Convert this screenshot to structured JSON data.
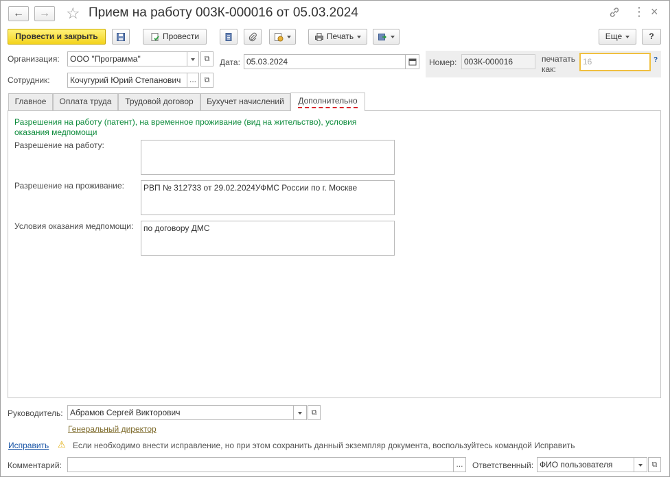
{
  "window": {
    "title": "Прием на работу 003К-000016 от 05.03.2024"
  },
  "toolbar": {
    "post_and_close": "Провести и закрыть",
    "post": "Провести",
    "print": "Печать",
    "more": "Еще",
    "help": "?"
  },
  "header": {
    "organization_label": "Организация:",
    "organization_value": "ООО \"Программа\"",
    "date_label": "Дата:",
    "date_value": "05.03.2024",
    "number_label": "Номер:",
    "number_value": "003К-000016",
    "print_as_label_1": "печатать",
    "print_as_label_2": "как:",
    "print_as_value": "16",
    "print_as_help": "?",
    "employee_label": "Сотрудник:",
    "employee_value": "Кочугурий Юрий Степанович"
  },
  "tabs": [
    {
      "label": "Главное"
    },
    {
      "label": "Оплата труда"
    },
    {
      "label": "Трудовой договор"
    },
    {
      "label": "Бухучет начислений"
    },
    {
      "label": "Дополнительно"
    }
  ],
  "additional": {
    "section_title_1": "Разрешения на работу (патент), на временное проживание (вид на жительство), условия",
    "section_title_2": "оказания медпомощи",
    "work_permit_label": "Разрешение на работу:",
    "work_permit_value": "",
    "residence_permit_label": "Разрешение на проживание:",
    "residence_permit_value": "РВП № 312733 от 29.02.2024УФМС России по г. Москве",
    "medical_label": "Условия оказания медпомощи:",
    "medical_value": "по договору ДМС"
  },
  "footer": {
    "manager_label": "Руководитель:",
    "manager_value": "Абрамов Сергей Викторович",
    "manager_position": "Генеральный директор",
    "fix_link": "Исправить",
    "fix_hint": "Если необходимо внести исправление, но при этом сохранить данный экземпляр документа, воспользуйтесь командой Исправить",
    "comment_label": "Комментарий:",
    "comment_value": "",
    "responsible_label": "Ответственный:",
    "responsible_value": "ФИО пользователя"
  },
  "colors": {
    "primary_button": "#f3d31c",
    "section_title": "#0b8a3a",
    "link": "#1a55a6",
    "active_tab_underline": "#d9232a",
    "print_as_border": "#f0c040"
  }
}
